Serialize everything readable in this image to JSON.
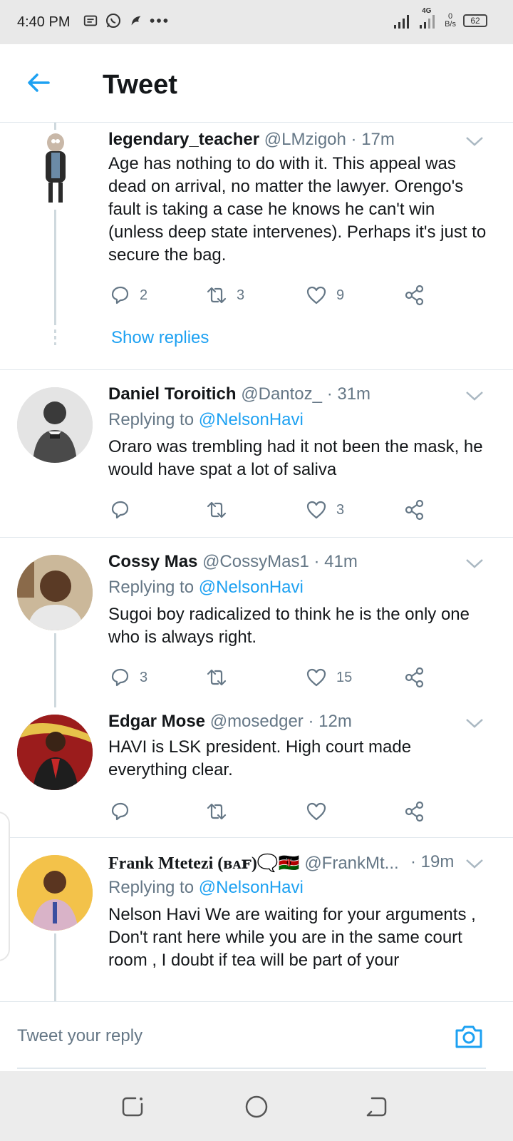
{
  "status_bar": {
    "time": "4:40 PM",
    "network": "4G",
    "speed_value": "0",
    "speed_unit": "B/s",
    "battery": "62"
  },
  "header": {
    "title": "Tweet"
  },
  "tweets": [
    {
      "name": "legendary_teacher",
      "handle": "@LMzigoh",
      "time": "· 17m",
      "text": "Age has nothing to do with it. This appeal was dead on arrival, no matter the lawyer. Orengo's fault is taking a case he knows he can't win (unless deep state intervenes). Perhaps it's just to secure the bag.",
      "replies": "2",
      "retweets": "3",
      "likes": "9",
      "show_replies": "Show replies"
    },
    {
      "name": "Daniel Toroitich",
      "handle": "@Dantoz_",
      "time": "· 31m",
      "replying_prefix": "Replying to",
      "replying_to": "@NelsonHavi",
      "text": "Oraro was trembling had it not been the mask, he would have spat a lot of saliva",
      "replies": "",
      "retweets": "",
      "likes": "3"
    },
    {
      "name": "Cossy Mas",
      "handle": "@CossyMas1",
      "time": "· 41m",
      "replying_prefix": "Replying to",
      "replying_to": "@NelsonHavi",
      "text": "Sugoi boy radicalized to think he is the only one who is always right.",
      "replies": "3",
      "retweets": "",
      "likes": "15"
    },
    {
      "name": "Edgar Mose",
      "handle": "@mosedger",
      "time": "· 12m",
      "text": "HAVI is LSK president. High court made everything clear.",
      "replies": "",
      "retweets": "",
      "likes": ""
    },
    {
      "name": "Frank Mtetezi (ʙᴀꜰ)🗨️🇰🇪",
      "handle": "@FrankMt...",
      "time": "· 19m",
      "replying_prefix": "Replying to",
      "replying_to": "@NelsonHavi",
      "text": "Nelson Havi We are waiting for your arguments , Don't rant here while you are in the same court room , I doubt if tea will be part of your"
    }
  ],
  "reply_bar": {
    "placeholder": "Tweet your reply"
  },
  "colors": {
    "accent": "#1da1f2",
    "muted": "#657786",
    "text": "#14171a"
  }
}
